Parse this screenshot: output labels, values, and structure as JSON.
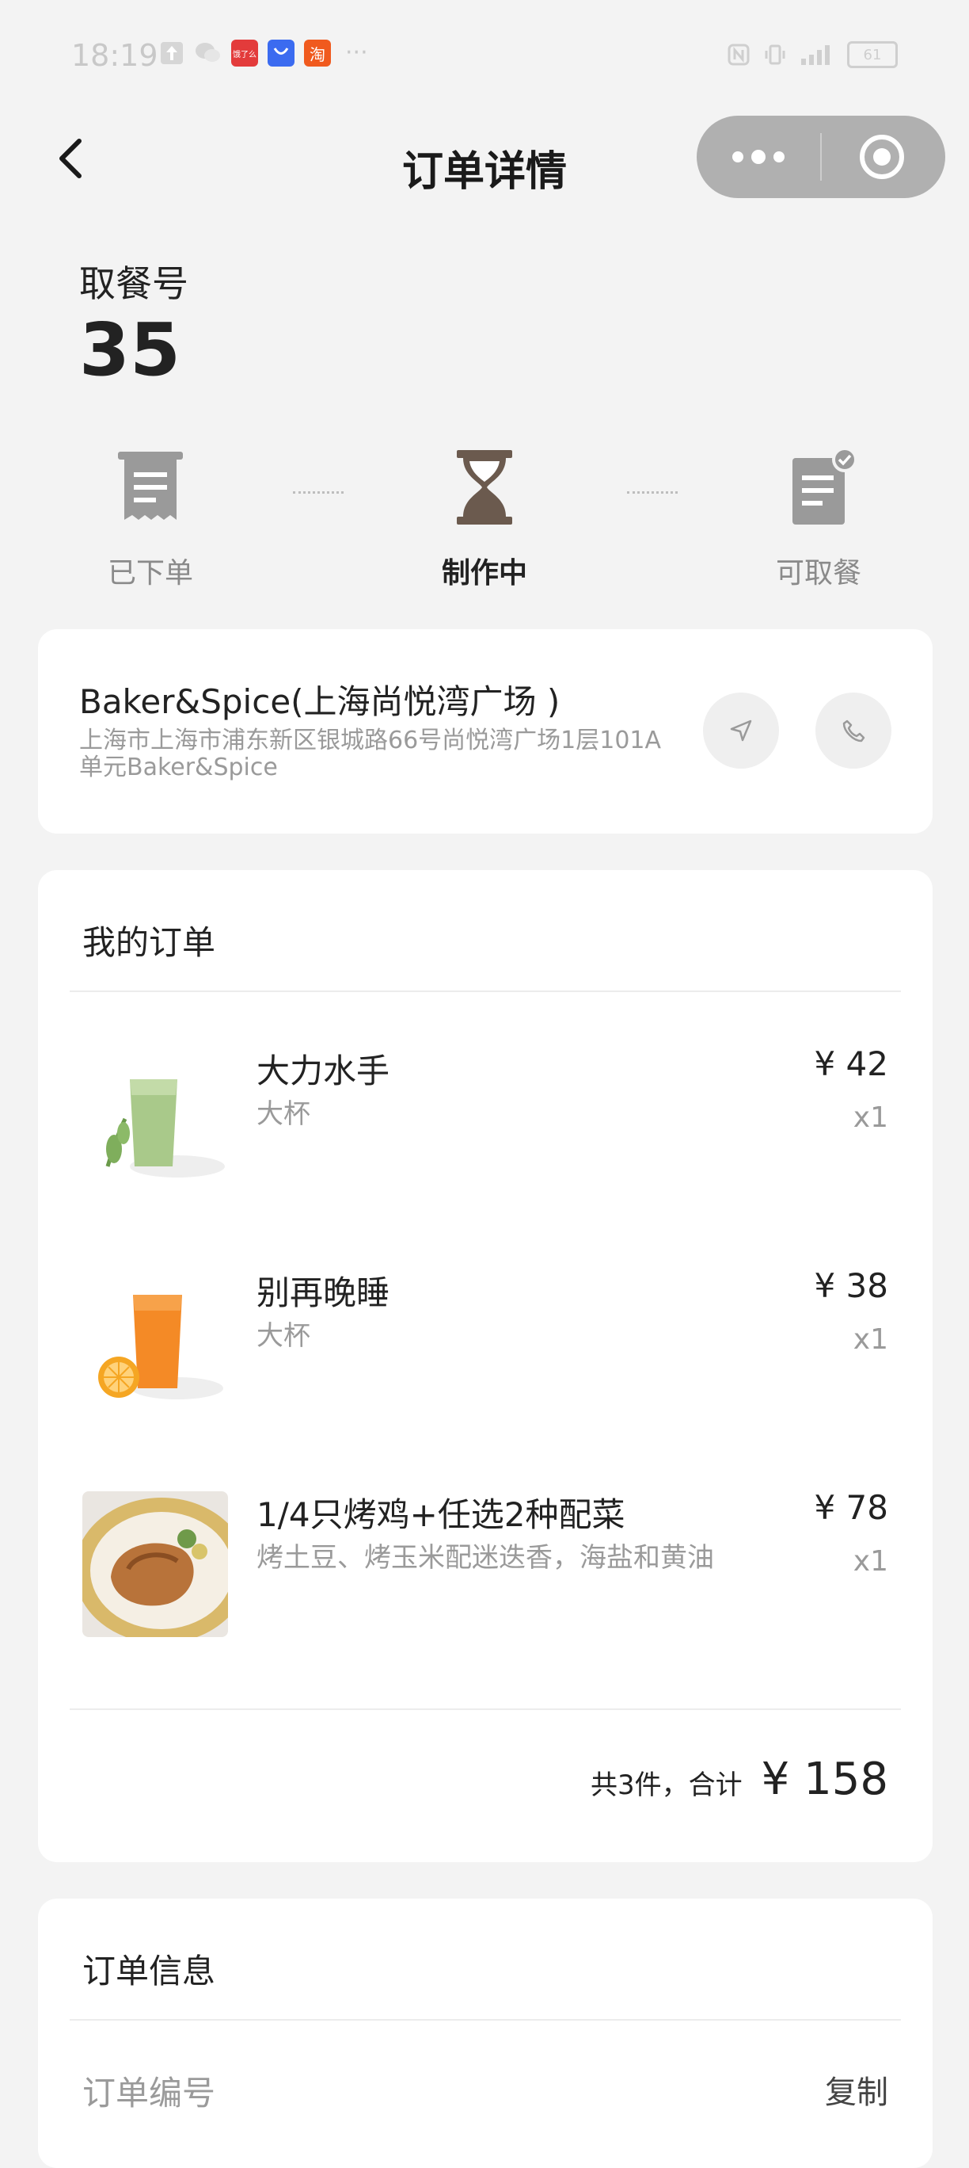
{
  "status_bar": {
    "time": "18:19",
    "battery": "61",
    "left_icons": [
      {
        "icon": "upload-icon",
        "color": "#ffffff"
      },
      {
        "icon": "wechat-icon",
        "color": "#ffffff"
      },
      {
        "icon": "app-icon",
        "color": "#e33b3b",
        "text": "饿了么"
      },
      {
        "icon": "app-icon",
        "color": "#3b6bf0",
        "text": ""
      },
      {
        "icon": "taobao-icon",
        "color": "#f05a1e",
        "text": "淘"
      }
    ],
    "more": "···"
  },
  "nav": {
    "title": "订单详情"
  },
  "pickup": {
    "label": "取餐号",
    "number": "35"
  },
  "progress": {
    "steps": [
      {
        "label": "已下单",
        "icon": "receipt-icon",
        "active": false
      },
      {
        "label": "制作中",
        "icon": "hourglass-icon",
        "active": true
      },
      {
        "label": "可取餐",
        "icon": "document-check-icon",
        "active": false
      }
    ]
  },
  "store": {
    "name": "Baker&Spice(上海尚悦湾广场 )",
    "address": "上海市上海市浦东新区银城路66号尚悦湾广场1层101A单元Baker&Spice"
  },
  "order": {
    "title": "我的订单",
    "items": [
      {
        "name": "大力水手",
        "spec": "大杯",
        "price": "¥ 42",
        "qty": "x1",
        "image": "green-juice"
      },
      {
        "name": "别再晚睡",
        "spec": "大杯",
        "price": "¥ 38",
        "qty": "x1",
        "image": "orange-juice"
      },
      {
        "name": "1/4只烤鸡+任选2种配菜",
        "spec": "烤土豆、烤玉米配迷迭香，海盐和黄油",
        "price": "¥ 78",
        "qty": "x1",
        "image": "roast-chicken"
      }
    ],
    "summary_text": "共3件，合计",
    "summary_total": "¥ 158"
  },
  "info": {
    "title": "订单信息",
    "order_no_label": "订单编号",
    "copy_label": "复制"
  },
  "colors": {
    "page_bg": "#f3f3f3",
    "card_bg": "#ffffff",
    "active_step": "#6b5a4e",
    "inactive_step": "#9a9a9a"
  }
}
